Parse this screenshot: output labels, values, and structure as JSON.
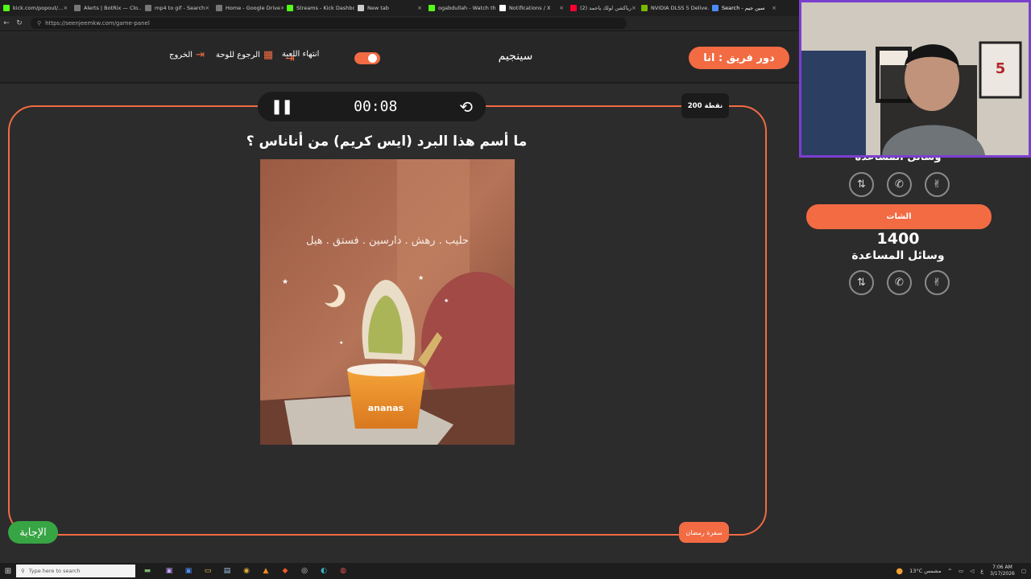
{
  "browser": {
    "tabs": [
      {
        "title": "kick.com/popout/...",
        "icon": "kick-icon",
        "color": "#53fc18",
        "active": false
      },
      {
        "title": "Alerts | BotRix — Clo...",
        "icon": "botrix-icon",
        "color": "#777777",
        "active": false
      },
      {
        "title": "mp4 to gif - Search",
        "icon": "search-tab-icon",
        "color": "#777777",
        "active": false
      },
      {
        "title": "Home - Google Drive",
        "icon": "drive-icon",
        "color": "#777777",
        "active": false
      },
      {
        "title": "Streams - Kick Dashbo...",
        "icon": "kick-icon",
        "color": "#53fc18",
        "active": false
      },
      {
        "title": "New tab",
        "icon": "newtab-icon",
        "color": "#cccccc",
        "active": false
      },
      {
        "title": "ogabdullah - Watch th...",
        "icon": "kick-icon",
        "color": "#53fc18",
        "active": false
      },
      {
        "title": "Notifications / X",
        "icon": "x-icon",
        "color": "#ffffff",
        "active": false
      },
      {
        "title": "(2) رياكشن لولك ياحمد",
        "icon": "youtube-icon",
        "color": "#ff0033",
        "active": false
      },
      {
        "title": "NVIDIA DLSS 5 Delive...",
        "icon": "nvidia-icon",
        "color": "#76b900",
        "active": false
      },
      {
        "title": "Search - سين جيم",
        "icon": "search-tab-icon",
        "color": "#4c8bf5",
        "active": true
      }
    ],
    "url": "https://seenjeemkw.com/game-panel"
  },
  "header": {
    "team_turn": "دور فريق : انا",
    "game_title": "سينجيم",
    "end_game": "انتهاء اللعبة",
    "back_to_board": "الرجوع للوحة",
    "exit": "الخروج"
  },
  "question_panel": {
    "timer": "00:08",
    "points": "200 نقطة",
    "question": "ما أسم هذا البرد (ايس كريم) من أناناس ؟",
    "image_caption": "حليب . رهش . دارسين . فستق . هيل",
    "image_cup_text": "ananas",
    "answer_button": "الإجابة",
    "category": "سفرة رمضان"
  },
  "side_panel": {
    "helpers_title_top": "وسائل المساعدة",
    "chat_button": "الشات",
    "score": "1400",
    "helpers_title": "وسائل المساعدة",
    "helpers": [
      "two-answers-icon",
      "phone-icon",
      "hand-icon"
    ]
  },
  "taskbar": {
    "search_placeholder": "Type here to search",
    "weather": "13°C  مشمس",
    "time": "7:06 AM",
    "date": "3/17/2026",
    "lang": "ع"
  },
  "colors": {
    "accent": "#f26b43",
    "answer": "#37a544",
    "webcam_border": "#7b3fd0"
  }
}
